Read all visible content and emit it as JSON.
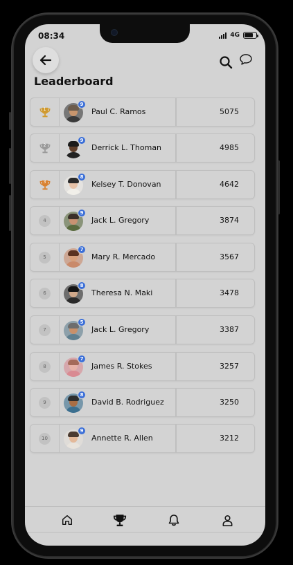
{
  "status": {
    "time": "08:34",
    "network": "4G",
    "battery_level": 0.75
  },
  "header": {
    "title": "Leaderboard"
  },
  "icons": {
    "back": "arrow-left-icon",
    "search": "search-icon",
    "chat": "chat-bubble-icon"
  },
  "trophy_colors": {
    "gold": "#d19a2e",
    "silver": "#9a9a9a",
    "bronze": "#d9812f"
  },
  "leaderboard": [
    {
      "rank": "1",
      "name": "Paul C. Ramos",
      "level": "9",
      "score": "5075",
      "trophy": "gold"
    },
    {
      "rank": "2",
      "name": "Derrick L. Thoman",
      "level": "9",
      "score": "4985",
      "trophy": "silver"
    },
    {
      "rank": "3",
      "name": "Kelsey T. Donovan",
      "level": "8",
      "score": "4642",
      "trophy": "bronze"
    },
    {
      "rank": "4",
      "name": "Jack L. Gregory",
      "level": "9",
      "score": "3874",
      "trophy": ""
    },
    {
      "rank": "5",
      "name": "Mary R. Mercado",
      "level": "7",
      "score": "3567",
      "trophy": ""
    },
    {
      "rank": "6",
      "name": "Theresa N. Maki",
      "level": "8",
      "score": "3478",
      "trophy": ""
    },
    {
      "rank": "7",
      "name": "Jack L. Gregory",
      "level": "5",
      "score": "3387",
      "trophy": ""
    },
    {
      "rank": "8",
      "name": "James R. Stokes",
      "level": "7",
      "score": "3257",
      "trophy": ""
    },
    {
      "rank": "9",
      "name": "David B. Rodriguez",
      "level": "8",
      "score": "3250",
      "trophy": ""
    },
    {
      "rank": "10",
      "name": "Annette R. Allen",
      "level": "9",
      "score": "3212",
      "trophy": ""
    }
  ],
  "bottom_nav": [
    {
      "icon": "home-icon",
      "active": false
    },
    {
      "icon": "trophy-icon",
      "active": true
    },
    {
      "icon": "bell-icon",
      "active": false
    },
    {
      "icon": "profile-icon",
      "active": false
    }
  ]
}
